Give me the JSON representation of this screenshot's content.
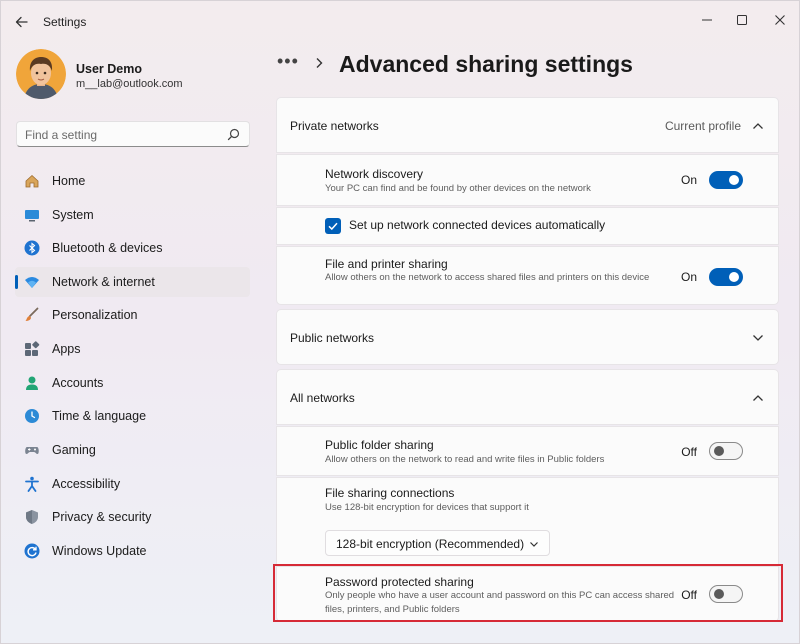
{
  "app": {
    "title": "Settings"
  },
  "profile": {
    "name": "User Demo",
    "email": "m__lab@outlook.com"
  },
  "search": {
    "placeholder": "Find a setting"
  },
  "nav": {
    "items": [
      {
        "label": "Home",
        "icon": "home-icon"
      },
      {
        "label": "System",
        "icon": "system-icon"
      },
      {
        "label": "Bluetooth & devices",
        "icon": "bluetooth-icon"
      },
      {
        "label": "Network & internet",
        "icon": "network-icon",
        "active": true
      },
      {
        "label": "Personalization",
        "icon": "brush-icon"
      },
      {
        "label": "Apps",
        "icon": "apps-icon"
      },
      {
        "label": "Accounts",
        "icon": "accounts-icon"
      },
      {
        "label": "Time & language",
        "icon": "clock-globe-icon"
      },
      {
        "label": "Gaming",
        "icon": "gamepad-icon"
      },
      {
        "label": "Accessibility",
        "icon": "accessibility-icon"
      },
      {
        "label": "Privacy & security",
        "icon": "shield-icon"
      },
      {
        "label": "Windows Update",
        "icon": "update-icon"
      }
    ]
  },
  "header": {
    "breadcrumb_more": "•••",
    "title": "Advanced sharing settings"
  },
  "private_networks": {
    "label": "Private networks",
    "status": "Current profile",
    "network_discovery": {
      "title": "Network discovery",
      "desc": "Your PC can find and be found by other devices on the network",
      "state": "On"
    },
    "auto_setup": {
      "label": "Set up network connected devices automatically",
      "checked": true
    },
    "file_printer_sharing": {
      "title": "File and printer sharing",
      "desc": "Allow others on the network to access shared files and printers on this device",
      "state": "On"
    }
  },
  "public_networks": {
    "label": "Public networks"
  },
  "all_networks": {
    "label": "All networks",
    "public_folder_sharing": {
      "title": "Public folder sharing",
      "desc": "Allow others on the network to read and write files in Public folders",
      "state": "Off"
    },
    "file_sharing_connections": {
      "title": "File sharing connections",
      "desc": "Use 128-bit encryption for devices that support it",
      "selected": "128-bit encryption (Recommended)"
    },
    "password_protected_sharing": {
      "title": "Password protected sharing",
      "desc": "Only people who have a user account and password on this PC can access shared files, printers, and Public folders",
      "state": "Off"
    }
  },
  "colors": {
    "accent": "#005fb8",
    "highlight": "#d62a36"
  }
}
